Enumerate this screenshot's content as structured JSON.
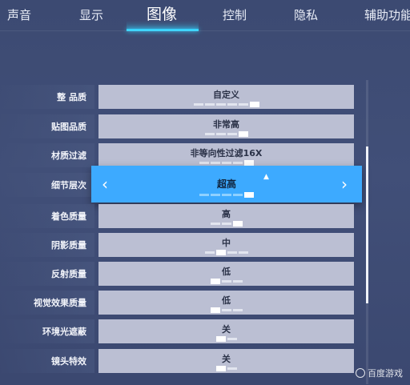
{
  "tabs": [
    {
      "label": "声音"
    },
    {
      "label": "显示"
    },
    {
      "label": "图像"
    },
    {
      "label": "控制"
    },
    {
      "label": "隐私"
    },
    {
      "label": "辅助功能"
    }
  ],
  "active_tab": "图像",
  "settings": [
    {
      "label": "整 品质",
      "value": "自定义",
      "level": 6,
      "steps": 6
    },
    {
      "label": "贴图品质",
      "value": "非常高",
      "level": 4,
      "steps": 4
    },
    {
      "label": "材质过滤",
      "value": "非等向性过滤16X",
      "level": 5,
      "steps": 5
    },
    {
      "label": "细节层次",
      "value": "超高",
      "level": 5,
      "steps": 5
    },
    {
      "label": "着色质量",
      "value": "高",
      "level": 3,
      "steps": 3
    },
    {
      "label": "阴影质量",
      "value": "中",
      "level": 2,
      "steps": 4
    },
    {
      "label": "反射质量",
      "value": "低",
      "level": 1,
      "steps": 3
    },
    {
      "label": "视觉效果质量",
      "value": "低",
      "level": 1,
      "steps": 3
    },
    {
      "label": "环境光遮蔽",
      "value": "关",
      "level": 1,
      "steps": 2
    },
    {
      "label": "镜头特效",
      "value": "关",
      "level": 1,
      "steps": 2
    }
  ],
  "selected_row": "细节层次",
  "arrows": {
    "left": "‹",
    "right": "›"
  },
  "watermark": "百度游戏",
  "colors": {
    "accent": "#38d4ff",
    "selected_bg": "#3daaff",
    "row_bg": "#bbbfd3",
    "page_bg": "#3f4c74"
  }
}
